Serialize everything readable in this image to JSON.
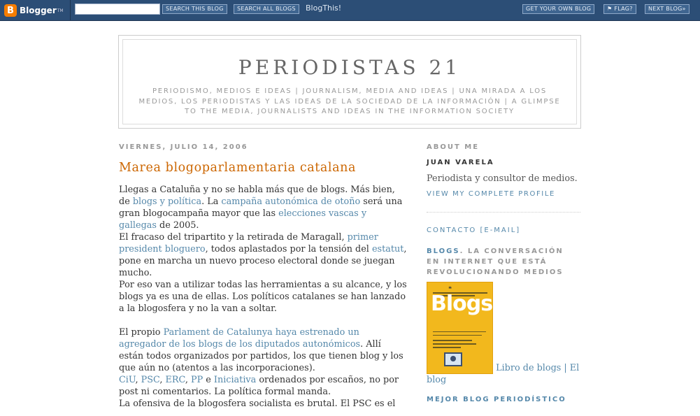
{
  "navbar": {
    "logo_letter": "B",
    "logo_text": "Blogger",
    "logo_tm": "TM",
    "search_value": "",
    "search_this_label": "SEARCH THIS BLOG",
    "search_all_label": "SEARCH ALL BLOGS",
    "blogthis_label": "BlogThis!",
    "get_own_label": "GET YOUR OWN BLOG",
    "flag_label": "⚑ FLAG?",
    "next_blog_label": "NEXT BLOG»",
    "bar_color": "#2c4e76",
    "logo_color": "#f57d00"
  },
  "header": {
    "title": "PERIODISTAS 21",
    "description": "Periodismo, medios e ideas | Journalism, media and ideas | Una mirada a los medios, los periodistas y las ideas de la sociedad de la información | A glimpse to the media, journalists and ideas in the information society"
  },
  "post": {
    "date": "viernes, julio 14, 2006",
    "title": "Marea blogoparlamentaria catalana",
    "p1_t1": "Llegas a Cataluña y no se habla más que de blogs. Más bien, de ",
    "p1_l1": "blogs y política",
    "p1_t2": ". La ",
    "p1_l2": "campaña autonómica de otoño",
    "p1_t3": " será una gran blogocampaña mayor que las ",
    "p1_l3": "elecciones vascas y gallegas",
    "p1_t4": " de 2005.",
    "p2_t1": "El fracaso del tripartito y la retirada de Maragall, ",
    "p2_l1": "primer president bloguero",
    "p2_t2": ", todos aplastados por la tensión del ",
    "p2_l2": "estatut",
    "p2_t3": ", pone en marcha un nuevo proceso electoral donde se juegan mucho.",
    "p3": "Por eso van a utilizar todas las herramientas a su alcance, y los blogs ya es una de ellas. Los políticos catalanes se han lanzado a la blogosfera y no la van a soltar.",
    "p4_t1": "El propio ",
    "p4_l1": "Parlament de Catalunya haya estrenado un agregador de los blogs de los diputados autonómicos",
    "p4_t2": ". Allí están todos organizados por partidos, los que tienen blog y los que aún no (atentos a las incorporaciones).",
    "p5_l1": "CiU",
    "p5_s1": ", ",
    "p5_l2": "PSC",
    "p5_s2": ", ",
    "p5_l3": "ERC",
    "p5_s3": ", ",
    "p5_l4": "PP",
    "p5_t1": " e ",
    "p5_l5": "Iniciativa",
    "p5_t2": " ordenados por escaños, no por post ni comentarios. La política formal manda.",
    "p6": "La ofensiva de la blogosfera socialista es brutal. El PSC es el"
  },
  "sidebar": {
    "about_head": "About Me",
    "profile_name": "Juan Varela",
    "profile_desc": "Periodista y consultor de medios.",
    "profile_link": "View my complete profile",
    "contact_link": "Contacto [e-mail]",
    "blogs_strong": "Blogs",
    "blogs_rest": ". La conversación en Internet que está revolucionando medios",
    "book_cover_title": "Blogs",
    "book_link": "Libro de blogs | El blog",
    "best_blog_head": "Mejor blog periodístico"
  },
  "colors": {
    "title_orange": "#cc6600",
    "link_blue": "#5588aa",
    "muted_gray": "#999999",
    "book_yellow": "#f2b81d"
  }
}
